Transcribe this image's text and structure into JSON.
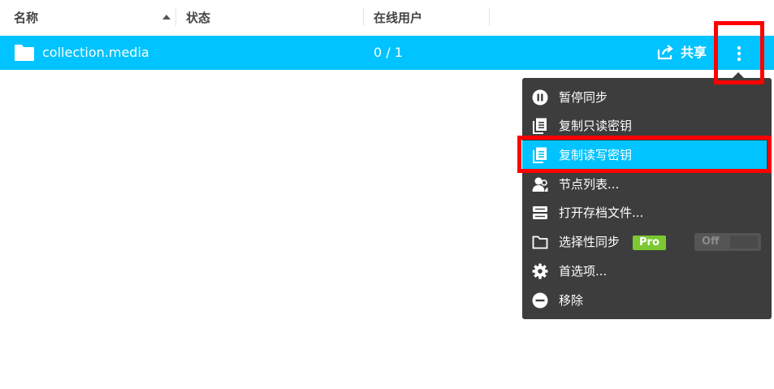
{
  "header": {
    "col_name": "名称",
    "col_status": "状态",
    "col_users": "在线用户"
  },
  "row": {
    "name": "collection.media",
    "users": "0 / 1",
    "share_label": "共享"
  },
  "menu": {
    "items": [
      {
        "label": "暂停同步",
        "icon": "pause-icon"
      },
      {
        "label": "复制只读密钥",
        "icon": "copy-icon"
      },
      {
        "label": "复制读写密钥",
        "icon": "copy-icon"
      },
      {
        "label": "节点列表...",
        "icon": "peers-icon"
      },
      {
        "label": "打开存档文件...",
        "icon": "archive-icon"
      },
      {
        "label": "选择性同步",
        "icon": "folder-icon"
      },
      {
        "label": "首选项...",
        "icon": "gear-icon"
      },
      {
        "label": "移除",
        "icon": "remove-icon"
      }
    ],
    "selective_badge": "Pro",
    "selective_toggle": "Off"
  },
  "colors": {
    "accent": "#00c3ff",
    "menu_bg": "#3d3d3d",
    "highlight": "#ff0000",
    "pro": "#7cc832"
  }
}
